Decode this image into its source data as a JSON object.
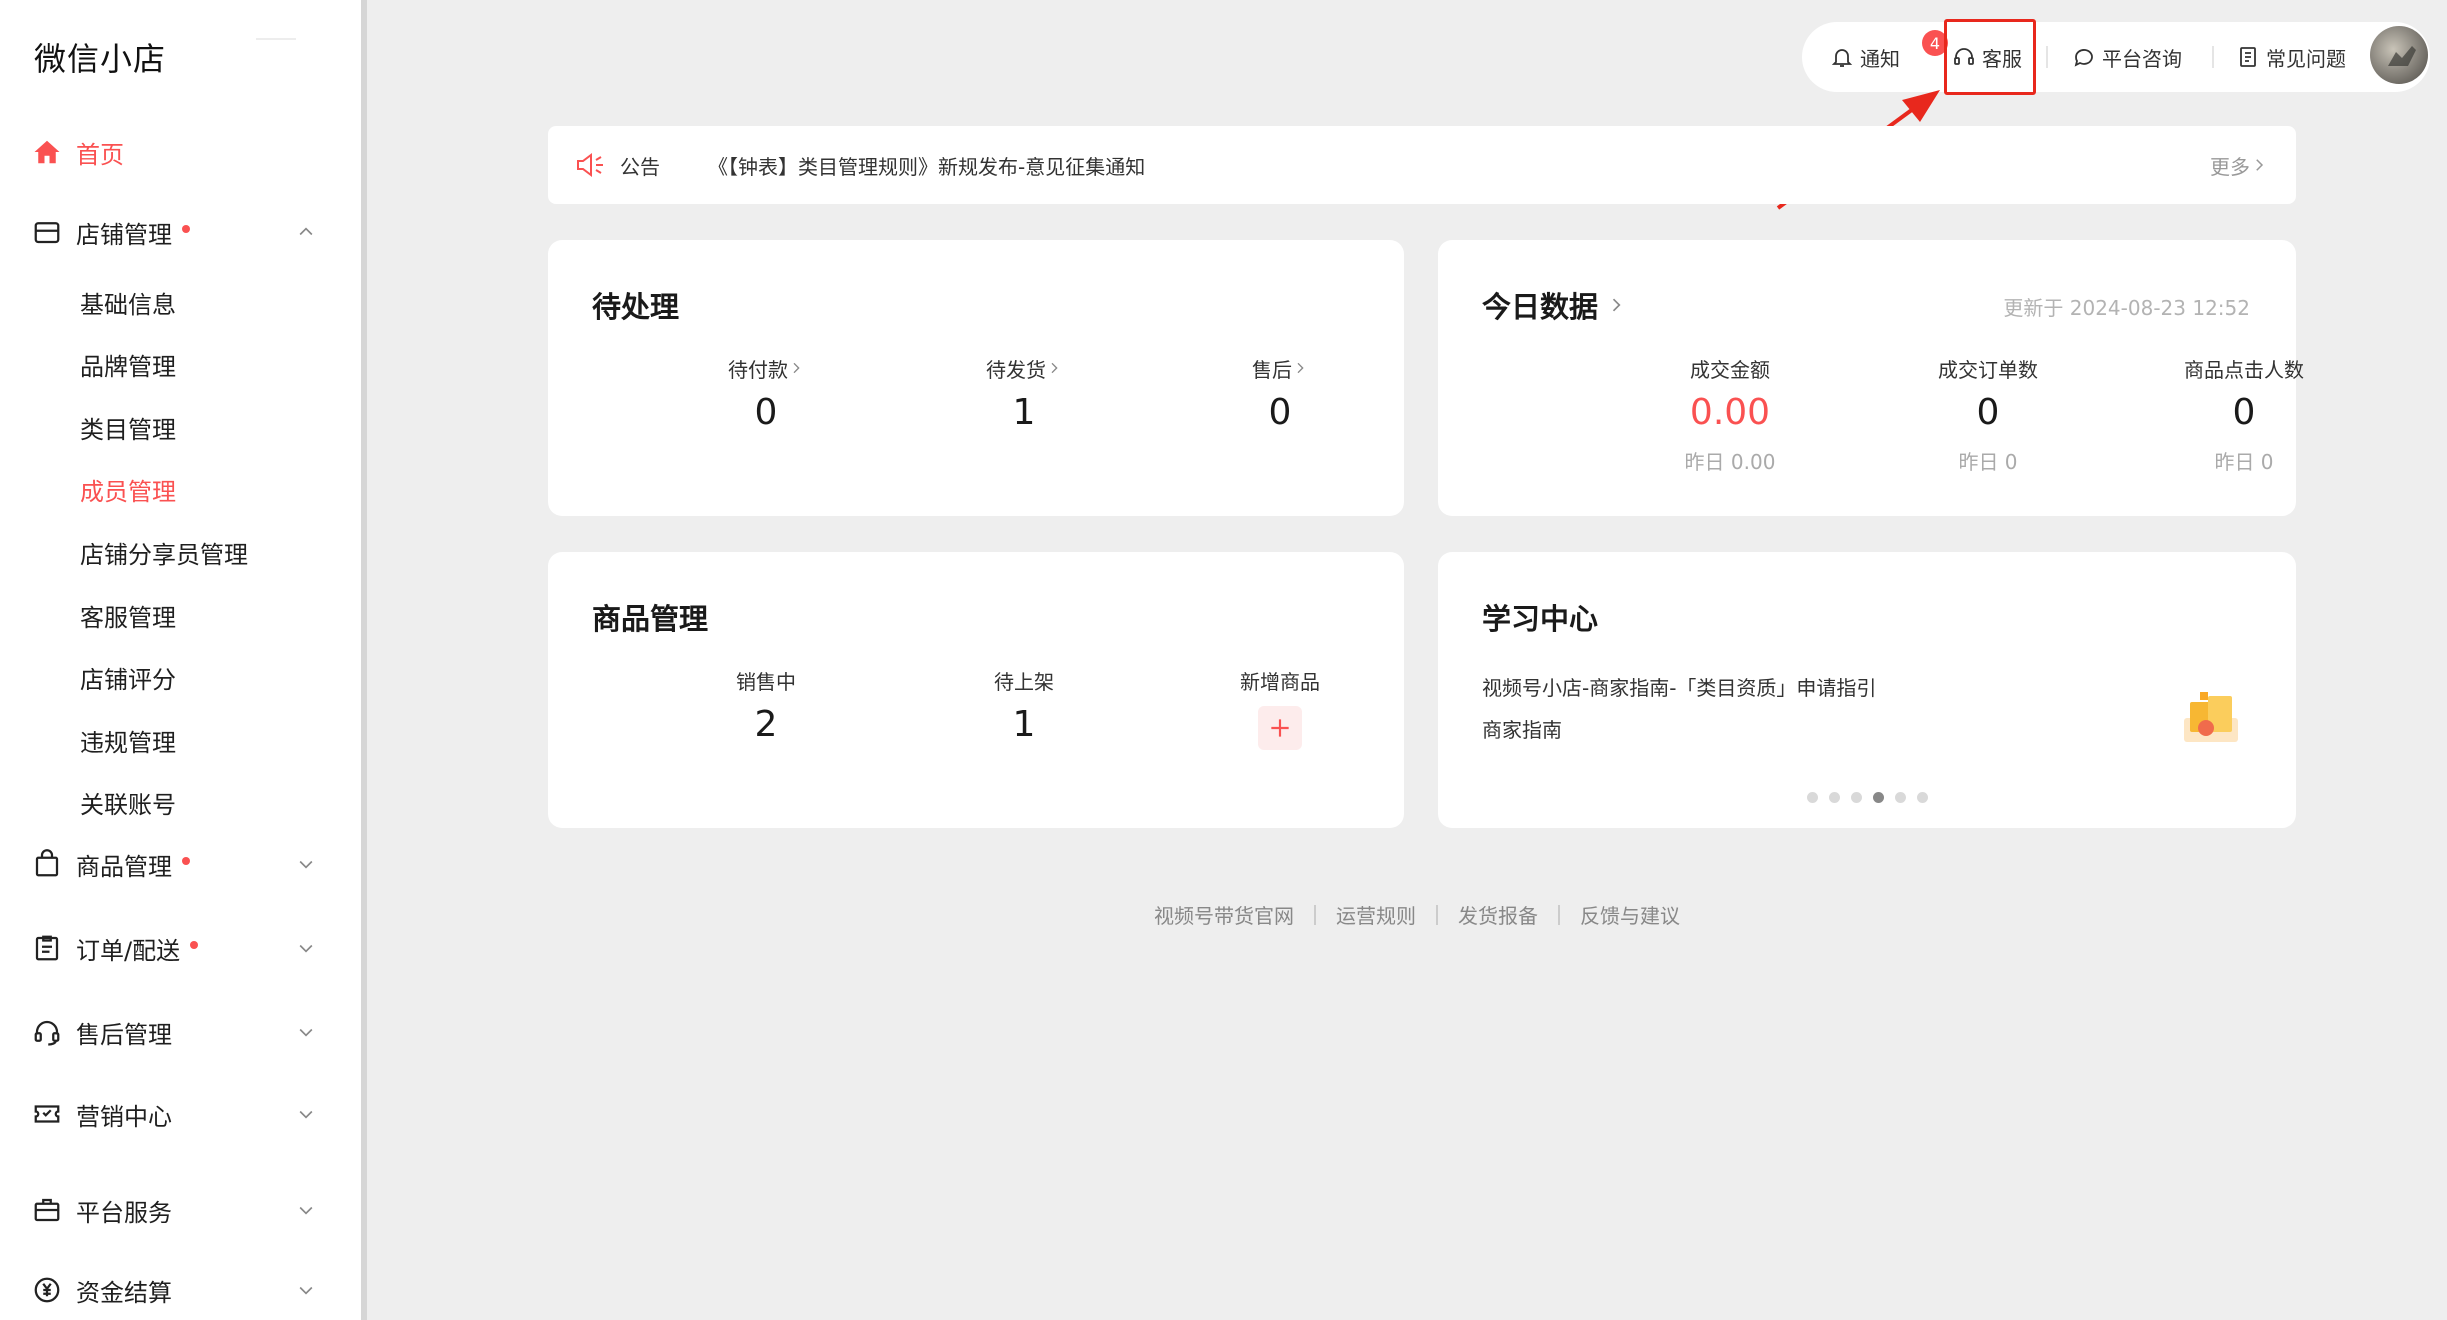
{
  "app": {
    "logo": "微信小店"
  },
  "sidebar": {
    "home": "首页",
    "shop": {
      "label": "店铺管理"
    },
    "shop_sub": [
      "基础信息",
      "品牌管理",
      "类目管理",
      "成员管理",
      "店铺分享员管理",
      "客服管理",
      "店铺评分",
      "违规管理",
      "关联账号"
    ],
    "goods": "商品管理",
    "orders": "订单/配送",
    "aftersale": "售后管理",
    "marketing": "营销中心",
    "platform": "平台服务",
    "funds": "资金结算"
  },
  "topbar": {
    "notify": "通知",
    "notify_count": "4",
    "service": "客服",
    "consult": "平台咨询",
    "faq": "常见问题"
  },
  "announcement": {
    "label": "公告",
    "text": "《【钟表】类目管理规则》新规发布-意见征集通知",
    "more": "更多"
  },
  "pending": {
    "title": "待处理",
    "items": [
      {
        "label": "待付款",
        "value": "0"
      },
      {
        "label": "待发货",
        "value": "1"
      },
      {
        "label": "售后",
        "value": "0"
      }
    ]
  },
  "today": {
    "title": "今日数据",
    "updated": "更新于 2024-08-23 12:52",
    "items": [
      {
        "label": "成交金额",
        "value": "0.00",
        "sub": "昨日 0.00"
      },
      {
        "label": "成交订单数",
        "value": "0",
        "sub": "昨日 0"
      },
      {
        "label": "商品点击人数",
        "value": "0",
        "sub": "昨日 0"
      }
    ]
  },
  "products": {
    "title": "商品管理",
    "items": [
      {
        "label": "销售中",
        "value": "2"
      },
      {
        "label": "待上架",
        "value": "1"
      },
      {
        "label": "新增商品"
      }
    ]
  },
  "learning": {
    "title": "学习中心",
    "article": "视频号小店-商家指南-「类目资质」申请指引",
    "category": "商家指南",
    "active_dot": 4,
    "dot_count": 6
  },
  "footer": {
    "links": [
      "视频号带货官网",
      "运营规则",
      "发货报备",
      "反馈与建议"
    ]
  },
  "colors": {
    "accent": "#fa5151",
    "highlight": "#e8281d"
  }
}
